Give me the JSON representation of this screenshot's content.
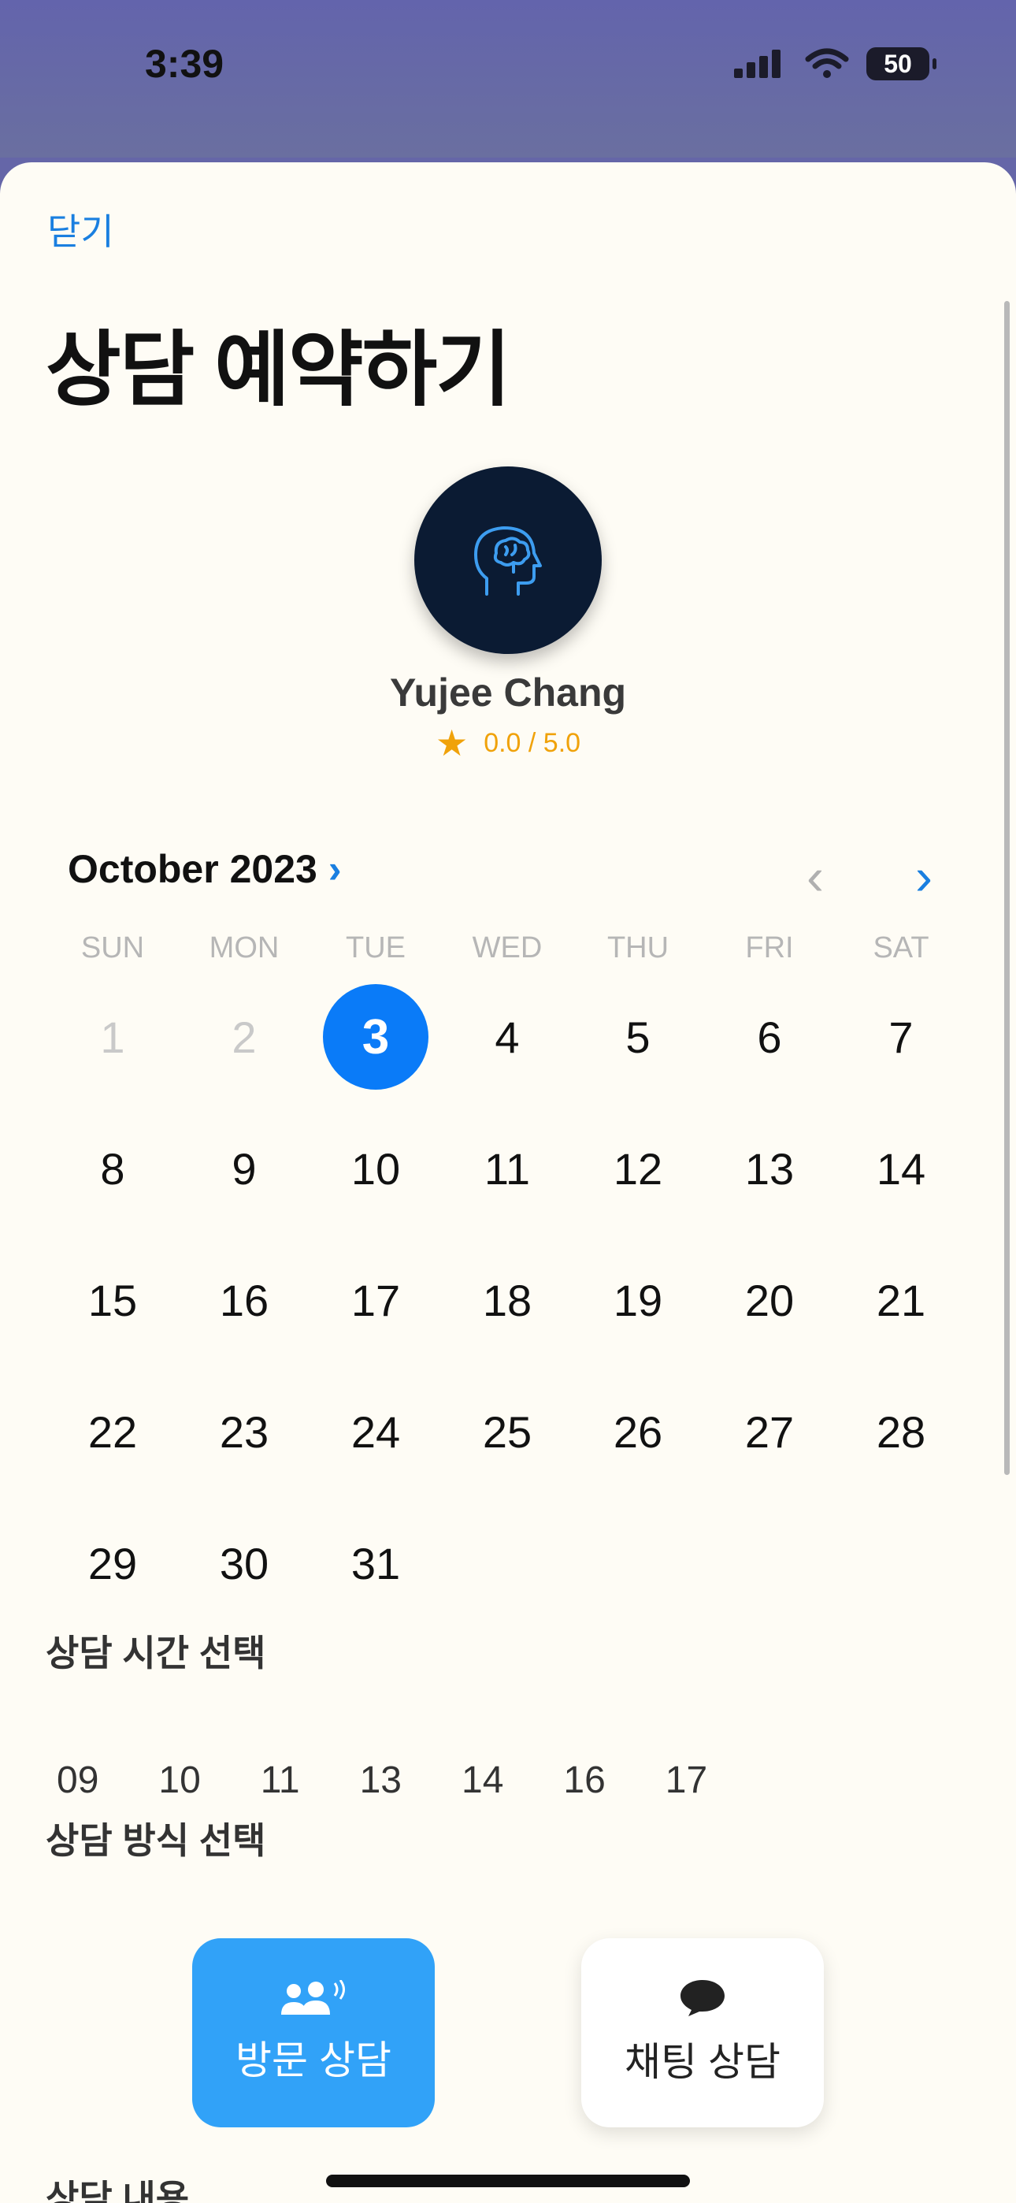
{
  "status_bar": {
    "time": "3:39",
    "battery": "50"
  },
  "sheet": {
    "close_label": "닫기",
    "title": "상담 예약하기"
  },
  "counselor": {
    "name": "Yujee Chang",
    "rating": "0.0 / 5.0",
    "avatar_icon": "brain-head-icon"
  },
  "calendar": {
    "month_label": "October 2023",
    "weekdays": [
      "SUN",
      "MON",
      "TUE",
      "WED",
      "THU",
      "FRI",
      "SAT"
    ],
    "days": [
      "1",
      "2",
      "3",
      "4",
      "5",
      "6",
      "7",
      "8",
      "9",
      "10",
      "11",
      "12",
      "13",
      "14",
      "15",
      "16",
      "17",
      "18",
      "19",
      "20",
      "21",
      "22",
      "23",
      "24",
      "25",
      "26",
      "27",
      "28",
      "29",
      "30",
      "31"
    ],
    "first_weekday_index": 0,
    "disabled_days": [
      "1",
      "2"
    ],
    "selected_day": "3"
  },
  "time_section": {
    "label": "상담 시간 선택",
    "options": [
      "09",
      "10",
      "11",
      "13",
      "14",
      "16",
      "17"
    ]
  },
  "method_section": {
    "label": "상담 방식 선택",
    "options": [
      {
        "label": "방문 상담",
        "icon": "people-icon",
        "selected": true
      },
      {
        "label": "채팅 상담",
        "icon": "chat-bubble-icon",
        "selected": false
      }
    ]
  },
  "content_section": {
    "label": "상담 내용"
  },
  "colors": {
    "accent": "#0a7bf8",
    "selected_method": "#31a2f8",
    "star": "#f0a20a",
    "header": "#6566a8"
  }
}
